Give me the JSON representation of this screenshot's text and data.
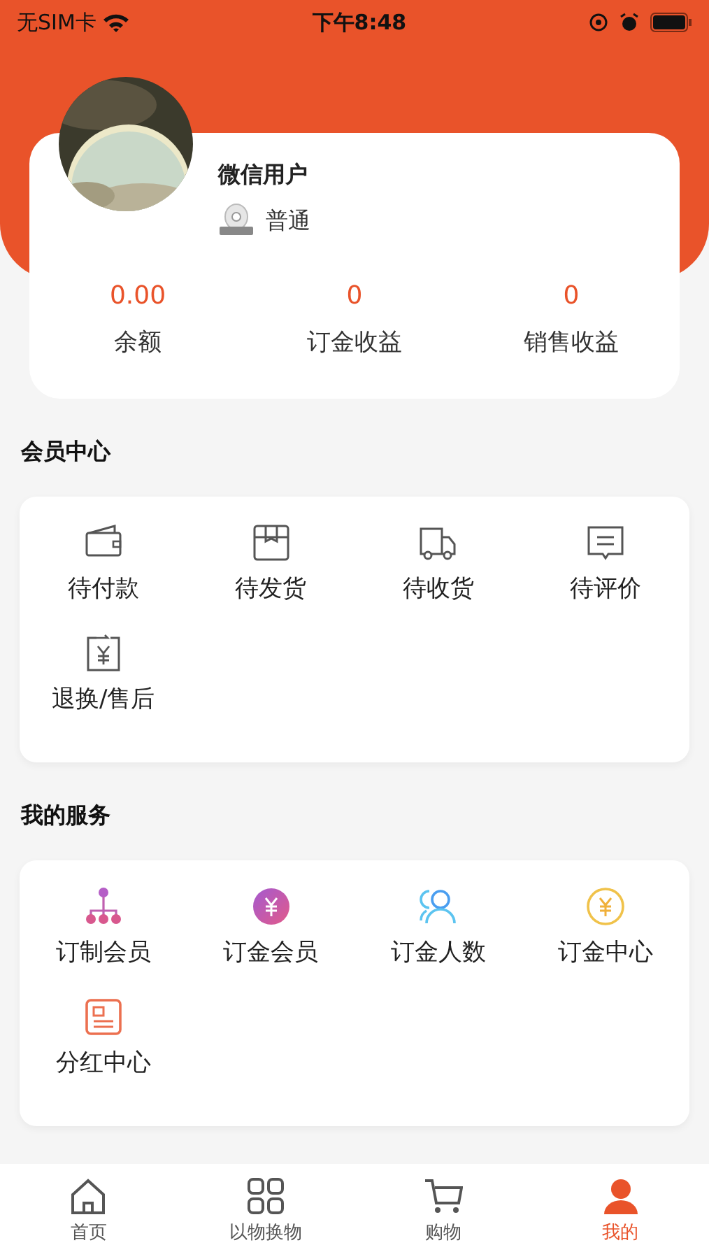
{
  "status_bar": {
    "carrier": "无SIM卡",
    "time": "下午8:48"
  },
  "profile": {
    "name": "微信用户",
    "level": "普通"
  },
  "stats": [
    {
      "value": "0.00",
      "label": "余额"
    },
    {
      "value": "0",
      "label": "订金收益"
    },
    {
      "value": "0",
      "label": "销售收益"
    }
  ],
  "sections": [
    {
      "title": "会员中心",
      "items": [
        {
          "label": "待付款"
        },
        {
          "label": "待发货"
        },
        {
          "label": "待收货"
        },
        {
          "label": "待评价"
        },
        {
          "label": "退换/售后"
        }
      ]
    },
    {
      "title": "我的服务",
      "items": [
        {
          "label": "订制会员"
        },
        {
          "label": "订金会员"
        },
        {
          "label": "订金人数"
        },
        {
          "label": "订金中心"
        },
        {
          "label": "分红中心"
        }
      ]
    }
  ],
  "tab_bar": [
    {
      "label": "首页",
      "selected": false
    },
    {
      "label": "以物换物",
      "selected": false
    },
    {
      "label": "购物",
      "selected": false
    },
    {
      "label": "我的",
      "selected": true
    }
  ]
}
